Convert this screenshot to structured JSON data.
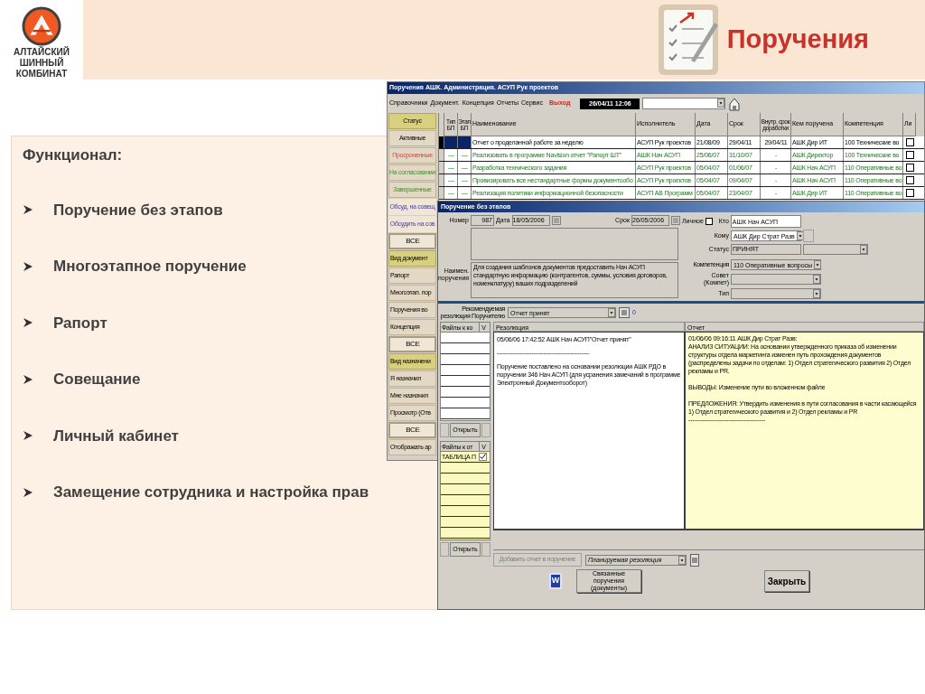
{
  "logo": {
    "lines": [
      "АЛТАЙСКИЙ",
      "ШИННЫЙ",
      "КОМБИНАТ"
    ]
  },
  "header": {
    "title": "Поручения"
  },
  "panel": {
    "heading": "Функционал:",
    "bullets": [
      "Поручение без этапов",
      "Многоэтапное поручение",
      "Рапорт",
      "Совещание",
      "Личный кабинет",
      "Замещение сотрудника и настройка прав"
    ]
  },
  "main_window": {
    "title": "Поручения АШК. Администрация. АСУП Рук проектов",
    "menu": [
      "Справочники",
      "Документ.",
      "Концепция",
      "Отчеты",
      "Сервис"
    ],
    "exit": "Выход",
    "datetime": "26/04/11 12:06",
    "sidebar": [
      {
        "kind": "header",
        "label": "Статус"
      },
      {
        "kind": "button",
        "label": "Активные"
      },
      {
        "kind": "overdue",
        "label": "Просроченные"
      },
      {
        "kind": "approval",
        "label": "На согласовании"
      },
      {
        "kind": "approval",
        "label": "Завершенные"
      },
      {
        "kind": "link",
        "label": "Обсуд. на совещ"
      },
      {
        "kind": "link",
        "label": "Обсудить на сов"
      },
      {
        "kind": "all",
        "label": "ВСЕ"
      },
      {
        "kind": "header",
        "label": "Вид документ"
      },
      {
        "kind": "button",
        "label": "Рапорт"
      },
      {
        "kind": "button",
        "label": "Многоэтап. пор"
      },
      {
        "kind": "button",
        "label": "Поручения во"
      },
      {
        "kind": "button",
        "label": "Концепция"
      },
      {
        "kind": "all",
        "label": "ВСЕ"
      },
      {
        "kind": "header",
        "label": "Вид назначени"
      },
      {
        "kind": "button",
        "label": "Я назначил"
      },
      {
        "kind": "button",
        "label": "Мне назначил"
      },
      {
        "kind": "button",
        "label": "Просмотр (Отв"
      },
      {
        "kind": "all",
        "label": "ВСЕ"
      },
      {
        "kind": "button",
        "label": "Отображать ар"
      }
    ],
    "table": {
      "columns": [
        "Тип БП",
        "Этап БП",
        "Наименование",
        "Исполнитель",
        "Дата",
        "Срок",
        "Внутр. срок доработки",
        "Кем поручена",
        "Компетенция",
        "Ли"
      ],
      "rows": [
        {
          "selected": true,
          "done": false,
          "cells": [
            "",
            "",
            "Отчет о проделанной работе за неделю",
            "АСУП Рук проектов",
            "21/08/09",
            "29/04/11",
            "29/04/11",
            "АШК Дир ИТ",
            "100 Технические во"
          ],
          "checked": false
        },
        {
          "selected": false,
          "done": true,
          "cells": [
            "—",
            "—",
            "Реализовать в программе Navision отчет \"Рапорт ШТ\"",
            "АШК Нач АСУП",
            "25/06/07",
            "31/10/07",
            "-",
            "АШК Директор",
            "100 Технические во"
          ],
          "checked": false
        },
        {
          "selected": false,
          "done": true,
          "cells": [
            "—",
            "—",
            "Разработка технического задания",
            "АСУП Рук проектов",
            "05/04/07",
            "01/06/07",
            "-",
            "АШК Нач АСУП",
            "110 Оперативные во"
          ],
          "checked": false
        },
        {
          "selected": false,
          "done": true,
          "cells": [
            "—",
            "—",
            "Провизировать все нестандартные формы документообо",
            "АСУП Рук проектов",
            "05/04/07",
            "09/04/07",
            "-",
            "АШК Нач АСУП",
            "110 Оперативные во"
          ],
          "checked": false
        },
        {
          "selected": false,
          "done": true,
          "cells": [
            "—",
            "—",
            "Реализация политики информационной безопасности",
            "АСУП АВ Программ",
            "05/04/07",
            "23/04/07",
            "-",
            "АШК Дир ИТ",
            "110 Оперативные во"
          ],
          "checked": false
        }
      ]
    }
  },
  "dialog": {
    "title": "Поручение без этапов",
    "number_label": "Номер",
    "number": "987",
    "date_label": "Дата",
    "date": "18/05/2006",
    "due_label": "Срок",
    "due": "26/05/2006",
    "personal_label": "Личное",
    "personal": false,
    "who_label": "Кто",
    "who": "АШК Нач АСУП",
    "to_label": "Кому",
    "to": "АШК Дир Страт Разв",
    "status_label": "Статус",
    "status": "ПРИНЯТ",
    "name_label": "Наимен. поручения",
    "name": "Для создания шаблонов документов предоставить Нач АСУП стандартную информацию (контрагентов, суммы, условия договоров, номенклатуру) ваших подразделений",
    "competence_label": "Компетенция",
    "competence": "110 Оперативные вопросы",
    "council_label": "Совет (Компет)",
    "type_label": "Тип",
    "recommended_label": "Рекомендуемая резолюция Поручителю",
    "recommended": "Отчет принят",
    "recommended_count": "0",
    "files_in": {
      "header": "Файлы к ко",
      "v": "V",
      "open": "Открыть"
    },
    "files_out": {
      "header": "Файлы к от",
      "v": "V",
      "open": "Открыть",
      "rows": [
        {
          "name": "ТАБЛИЦА П",
          "checked": true
        }
      ]
    },
    "resolution_header": "Резолюция",
    "resolution_lines": [
      "05/06/06 17:42:52  АШК Нач АСУП\"Отчет принят\"",
      "------------------------------------------------",
      "Поручение поставлено на основании резолюции АШК РДО в поручении 346 Нач АСУП (для усранения замечаний в программе Электронный Документооборот)"
    ],
    "report_header": "Отчет",
    "report_paragraphs": [
      [
        "01/06/06 09:16:11   АШК Дир Страт Разв:",
        "АНАЛИЗ СИТУАЦИИ: На основании  утвержденного приказа об изменении структуры отдела маркетинга изменен путь прохождения документов (распределены задачи по отделам: 1) Отдел стратегического развития 2) Отдел рекламы и PR."
      ],
      [
        "ВЫВОДЫ: Изменение пути во вложенном файле"
      ],
      [
        "ПРЕДЛОЖЕНИЯ: Утвердить изменения в пути согласования в  части касающейся 1) Отдел стратегического развития  и 2) Отдел рекламы и PR",
        "----------------------------------------"
      ]
    ],
    "add_report": {
      "label": "Добавить отчет в поручение",
      "disabled": true
    },
    "planned": "Планируемая резолюция",
    "word_label": "W",
    "linked": "Связанные поручения (документы)",
    "close": "Закрыть"
  }
}
